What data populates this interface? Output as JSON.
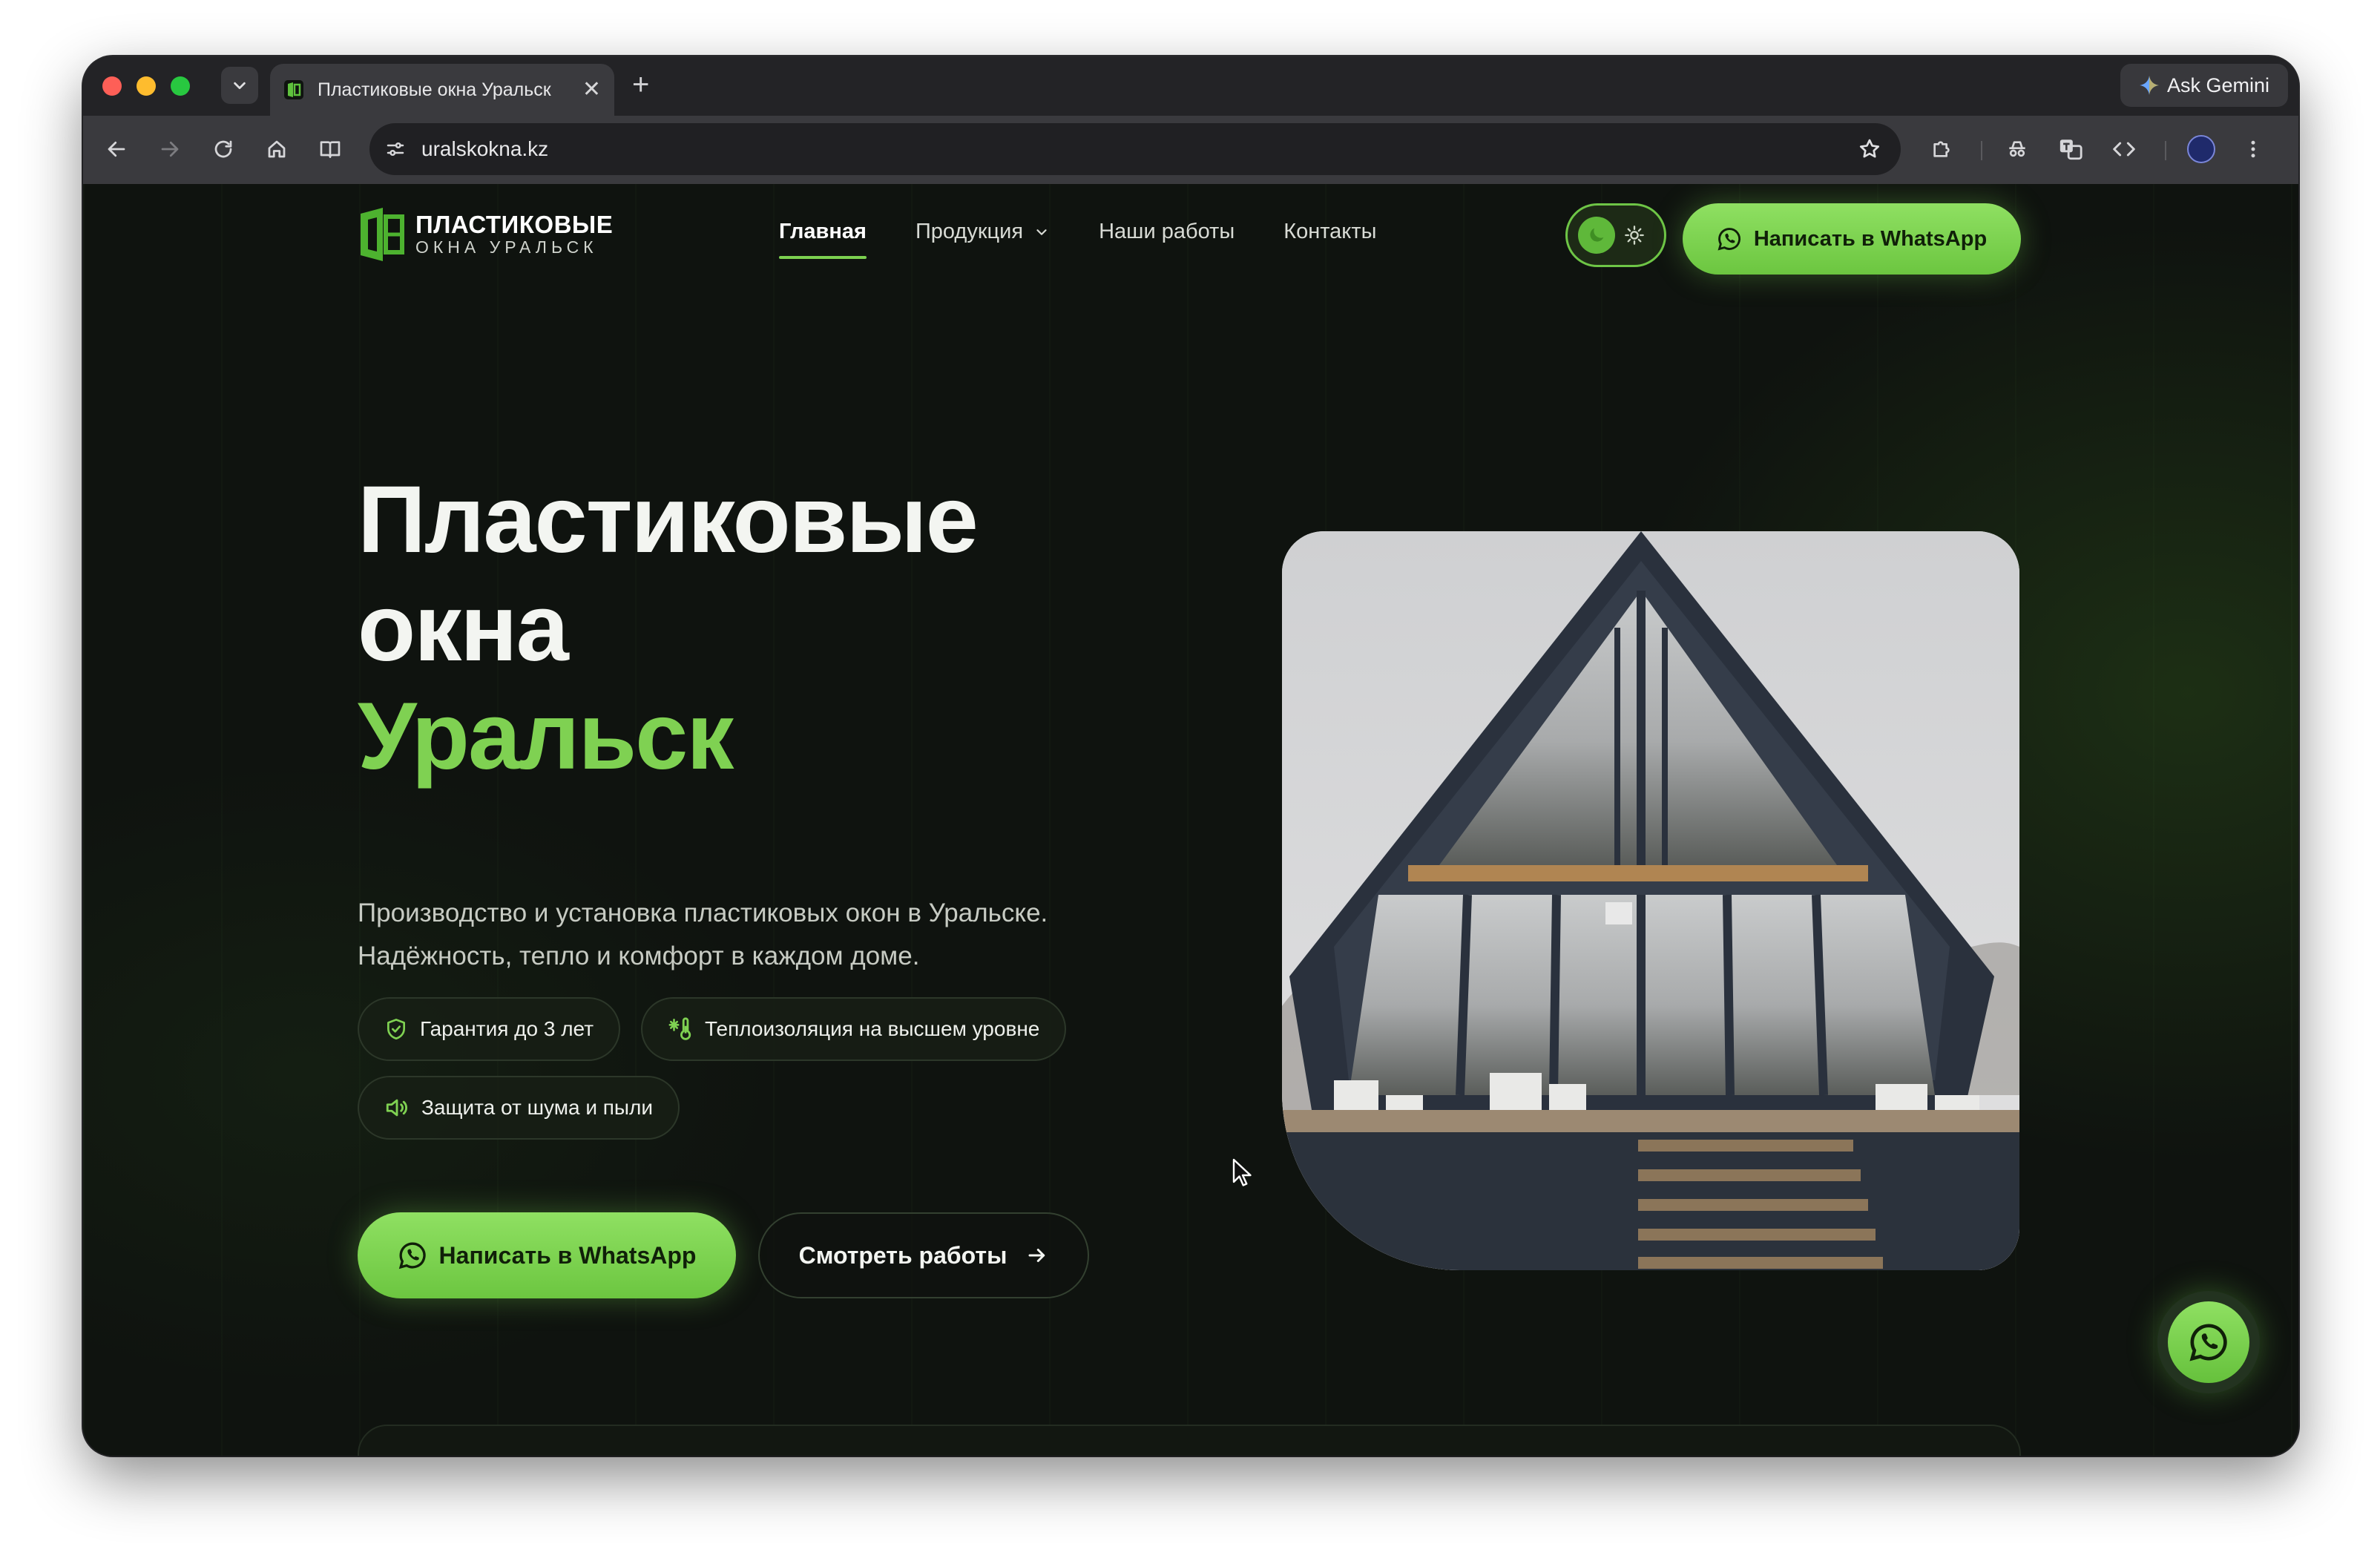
{
  "browser": {
    "tab_title": "Пластиковые окна Уральск",
    "tab_close": "✕",
    "new_tab": "+",
    "gemini_label": "Ask Gemini",
    "url": "uralskokna.kz"
  },
  "site": {
    "logo_line1": "ПЛАСТИКОВЫЕ",
    "logo_line2": "ОКНА УРАЛЬСК",
    "nav": [
      {
        "label": "Главная",
        "active": true
      },
      {
        "label": "Продукция",
        "dropdown": true
      },
      {
        "label": "Наши работы"
      },
      {
        "label": "Контакты"
      }
    ],
    "header_cta": "Написать в WhatsApp",
    "hero": {
      "title_line1": "Пластиковые",
      "title_line2": "окна",
      "title_accent": "Уральск",
      "lead_line1": "Производство и установка пластиковых окон в Уральске.",
      "lead_line2": "Надёжность, тепло и комфорт в каждом доме."
    },
    "features": [
      {
        "label": "Гарантия до 3 лет",
        "icon": "shield-check-icon"
      },
      {
        "label": "Теплоизоляция на высшем уровне",
        "icon": "thermometer-snow-icon"
      },
      {
        "label": "Защита от шума и пыли",
        "icon": "speaker-wave-icon"
      }
    ],
    "cta_primary": "Написать в WhatsApp",
    "cta_secondary": "Смотреть работы"
  },
  "colors": {
    "accent": "#7fd152",
    "background": "#0f130f",
    "button": "#8fe062"
  }
}
